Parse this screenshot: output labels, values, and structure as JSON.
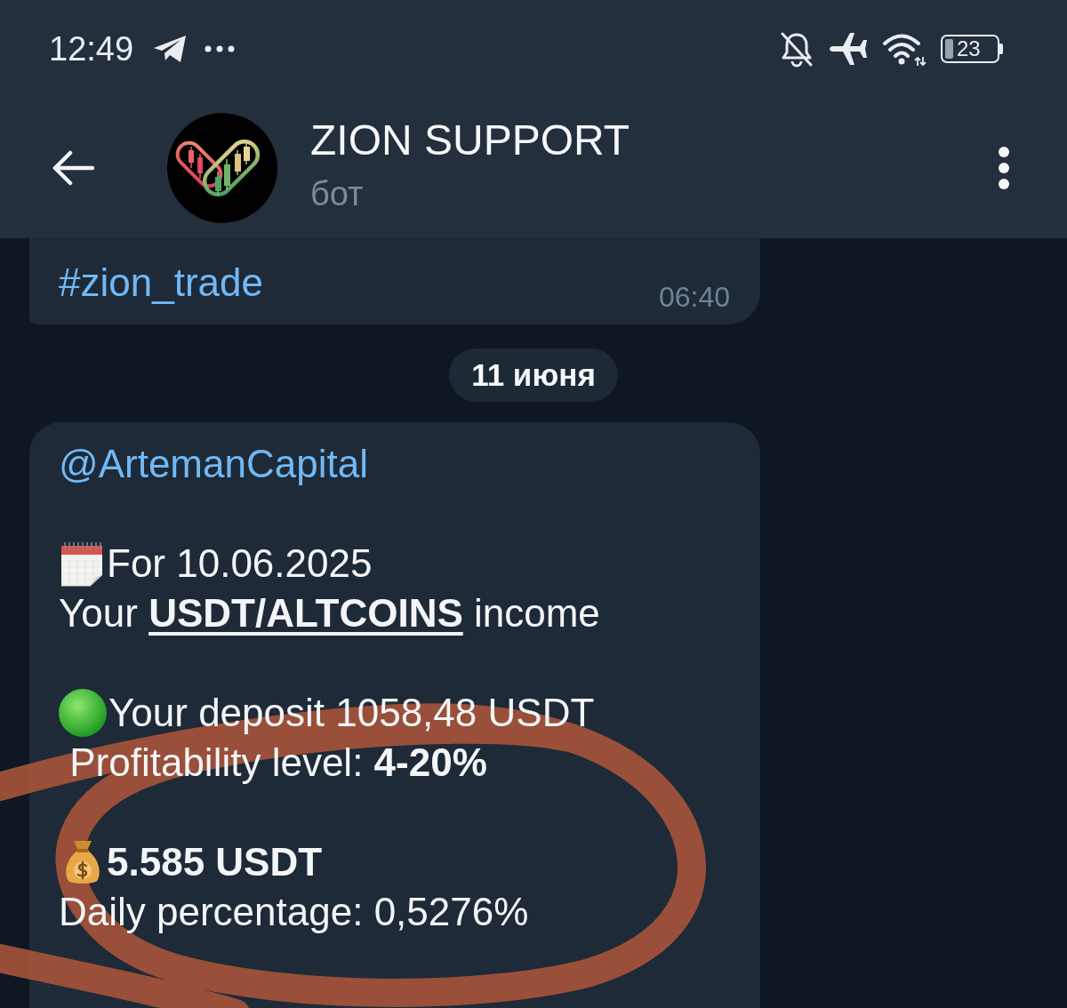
{
  "status_bar": {
    "time": "12:49",
    "battery": "23"
  },
  "header": {
    "title": "ZION SUPPORT",
    "subtitle": "бот"
  },
  "chat": [
    {
      "kind": "message",
      "paragraphs": [
        [
          {
            "kind": "link",
            "text": "#zion_trade",
            "bold": false,
            "underlined": false
          }
        ]
      ],
      "time": "06:40"
    },
    {
      "kind": "date",
      "text": "11 июня"
    },
    {
      "kind": "message",
      "paragraphs": [
        [
          {
            "kind": "link",
            "text": "@ArtemanCapital",
            "bold": false,
            "underlined": false
          }
        ],
        [
          {
            "kind": "calendar",
            "text": "For 10.06.2025",
            "bold": false,
            "underlined": false
          },
          {
            "kind": "text",
            "text": "Your **USDT/ALTCOINS** income",
            "bold": false,
            "underlined": true
          }
        ],
        [
          {
            "kind": "dot",
            "text": "Your deposit 1058,48 USDT",
            "bold": false,
            "underlined": false
          },
          {
            "kind": "text",
            "text": " Profitability level: **4-20%**",
            "bold": false,
            "underlined": false
          }
        ],
        [
          {
            "kind": "moneybag",
            "text": "5.585 USDT",
            "bold": true,
            "underlined": false
          },
          {
            "kind": "text",
            "text": "Daily percentage: 0,5276%",
            "bold": false,
            "underlined": false
          }
        ]
      ]
    }
  ]
}
